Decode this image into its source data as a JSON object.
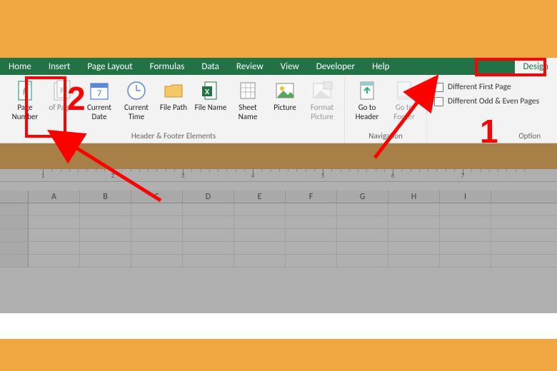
{
  "tabs": {
    "items": [
      {
        "label": "Home"
      },
      {
        "label": "Insert"
      },
      {
        "label": "Page Layout"
      },
      {
        "label": "Formulas"
      },
      {
        "label": "Data"
      },
      {
        "label": "Review"
      },
      {
        "label": "View"
      },
      {
        "label": "Developer"
      },
      {
        "label": "Help"
      },
      {
        "label": "Design",
        "active": true
      }
    ]
  },
  "ribbon": {
    "group_elements_label": "Header & Footer Elements",
    "group_nav_label": "Navigation",
    "group_opt_label": "Option",
    "page_number_label": "Page Number",
    "pages_label": "of Pages",
    "current_date_label": "Current Date",
    "current_time_label": "Current Time",
    "file_path_label": "File Path",
    "file_name_label": "File Name",
    "sheet_name_label": "Sheet Name",
    "picture_label": "Picture",
    "format_picture_label": "Format Picture",
    "goto_header_label": "Go to Header",
    "goto_footer_label": "Go to Footer",
    "diff_first_label": "Different First Page",
    "diff_odd_even_label": "Different Odd & Even Pages"
  },
  "columns": [
    "A",
    "B",
    "C",
    "D",
    "E",
    "F",
    "G",
    "H",
    "I"
  ],
  "ruler_numbers": [
    "1",
    "2",
    "3",
    "4",
    "5",
    "6",
    "7"
  ],
  "annotations": {
    "num1": "1",
    "num2": "2"
  }
}
